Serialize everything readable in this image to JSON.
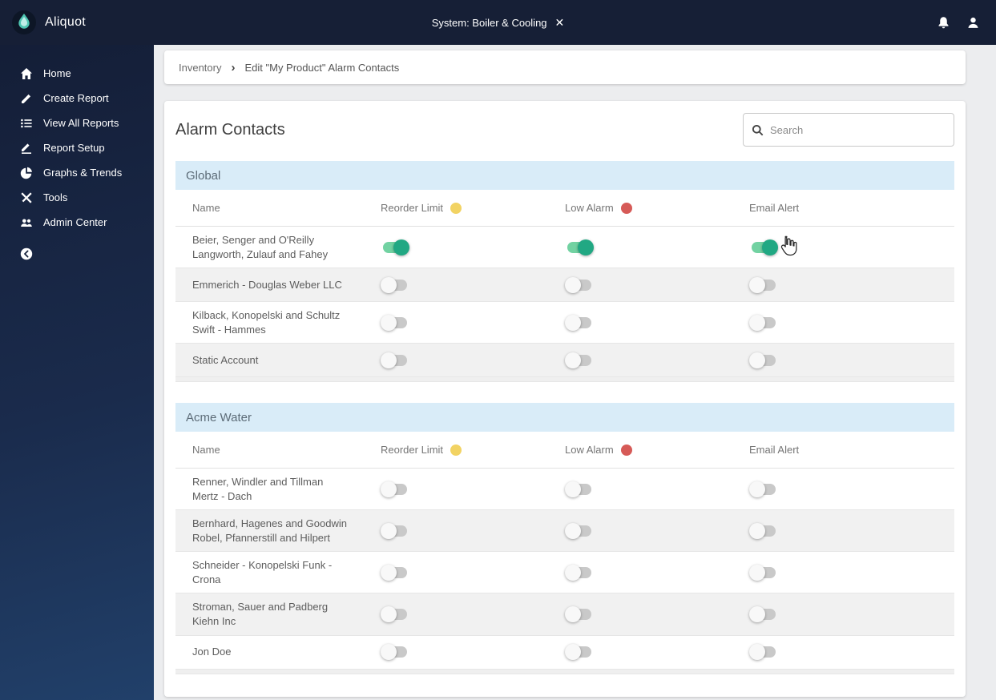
{
  "topbar": {
    "brand": "Aliquot",
    "system_label": "System: Boiler & Cooling",
    "close_label": "✕"
  },
  "sidebar": {
    "items": [
      {
        "id": "home",
        "label": "Home",
        "icon": "home-icon"
      },
      {
        "id": "create-report",
        "label": "Create Report",
        "icon": "pencil-icon"
      },
      {
        "id": "view-all-reports",
        "label": "View All Reports",
        "icon": "list-icon"
      },
      {
        "id": "report-setup",
        "label": "Report Setup",
        "icon": "report-setup-icon"
      },
      {
        "id": "graphs-trends",
        "label": "Graphs & Trends",
        "icon": "pie-chart-icon"
      },
      {
        "id": "tools",
        "label": "Tools",
        "icon": "tools-icon"
      },
      {
        "id": "admin-center",
        "label": "Admin Center",
        "icon": "users-icon"
      }
    ]
  },
  "breadcrumb": {
    "items": [
      "Inventory",
      "Edit \"My Product\" Alarm Contacts"
    ]
  },
  "main": {
    "title": "Alarm Contacts",
    "search_placeholder": "Search",
    "columns": [
      "Name",
      "Reorder Limit",
      "Low Alarm",
      "Email Alert"
    ],
    "groups": [
      {
        "name": "Global",
        "rows": [
          {
            "name": "Beier, Senger and O'Reilly Langworth, Zulauf and Fahey",
            "reorder": true,
            "low_alarm": true,
            "email": true
          },
          {
            "name": "Emmerich - Douglas Weber LLC",
            "reorder": false,
            "low_alarm": false,
            "email": false
          },
          {
            "name": "Kilback, Konopelski and Schultz Swift - Hammes",
            "reorder": false,
            "low_alarm": false,
            "email": false
          },
          {
            "name": "Static Account",
            "reorder": false,
            "low_alarm": false,
            "email": false
          }
        ]
      },
      {
        "name": "Acme Water",
        "rows": [
          {
            "name": "Renner, Windler and Tillman Mertz - Dach",
            "reorder": false,
            "low_alarm": false,
            "email": false
          },
          {
            "name": "Bernhard, Hagenes and Goodwin Robel, Pfannerstill and Hilpert",
            "reorder": false,
            "low_alarm": false,
            "email": false
          },
          {
            "name": "Schneider - Konopelski Funk - Crona",
            "reorder": false,
            "low_alarm": false,
            "email": false
          },
          {
            "name": "Stroman, Sauer and Padberg Kiehn Inc",
            "reorder": false,
            "low_alarm": false,
            "email": false
          },
          {
            "name": "Jon Doe",
            "reorder": false,
            "low_alarm": false,
            "email": false
          }
        ]
      }
    ]
  },
  "colors": {
    "toggle_on_track": "#72d2a2",
    "toggle_on_thumb": "#21a883",
    "reorder_dot": "#f2d363",
    "low_alarm_dot": "#d65a57",
    "topbar_bg": "#161f36",
    "group_band_bg": "#d9ecf8"
  }
}
